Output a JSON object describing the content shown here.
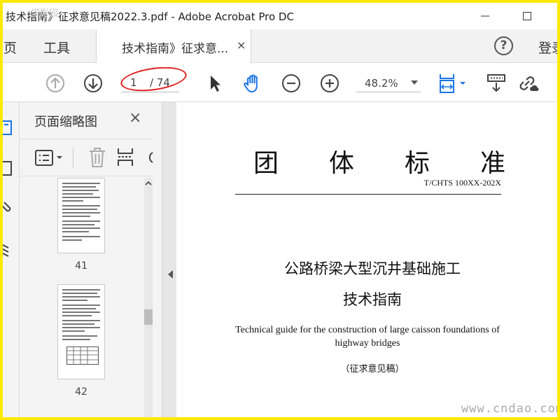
{
  "window": {
    "title": "技术指南》征求意见稿2022.3.pdf - Adobe Acrobat Pro DC",
    "watermark_topleft": "学影园"
  },
  "menu": {
    "home": "主页",
    "tools": "工具",
    "tab_label": "技术指南》征求意...",
    "tab_close": "×",
    "help": "?",
    "sign_in": "登录"
  },
  "toolbar": {
    "page_current": "1",
    "page_total": "/ 74",
    "zoom": "48.2%"
  },
  "panel": {
    "title": "页面缩略图",
    "close": "×",
    "thumbnails": [
      {
        "label": "41"
      },
      {
        "label": "42"
      }
    ]
  },
  "document": {
    "heading_chars": [
      "团",
      "体",
      "标",
      "准"
    ],
    "code": "T/CHTS 100XX-202X",
    "title_line1": "公路桥梁大型沉井基础施工",
    "title_line2": "技术指南",
    "english_title": "Technical guide for the construction of large caisson foundations of highway bridges",
    "draft_label": "（征求意见稿）"
  },
  "watermark": "www.cndao.com",
  "colors": {
    "frame_border": "#ffe900",
    "annotation_ring": "#e02020",
    "hand_tool_active": "#1a73e8"
  }
}
